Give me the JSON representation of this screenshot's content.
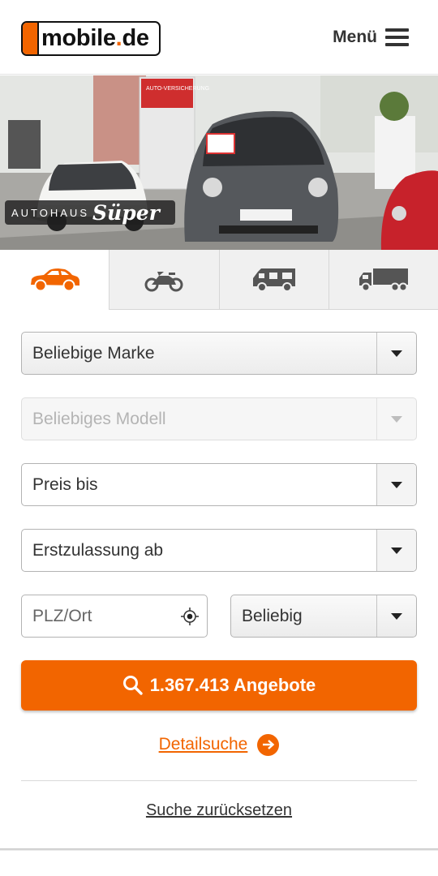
{
  "header": {
    "logo": {
      "text_main": "mobile",
      "text_dot": ".",
      "text_tld": "de"
    },
    "menu_label": "Menü",
    "menu_icon": "hamburger-icon"
  },
  "hero": {
    "dealer_prefix": "AUTOHAUS",
    "dealer_name": "Süper",
    "poster_text": "AUTO-VERSICHERUNG"
  },
  "vehicle_tabs": [
    {
      "icon": "car-icon",
      "active": true
    },
    {
      "icon": "motorcycle-icon",
      "active": false
    },
    {
      "icon": "motorhome-icon",
      "active": false
    },
    {
      "icon": "truck-icon",
      "active": false
    }
  ],
  "form": {
    "make": "Beliebige Marke",
    "model": "Beliebiges Modell",
    "price": "Preis bis",
    "first_registration": "Erstzulassung ab",
    "zip_placeholder": "PLZ/Ort",
    "radius": "Beliebig"
  },
  "search_button": {
    "label": "1.367.413 Angebote",
    "icon": "search-icon"
  },
  "detail_search": "Detailsuche",
  "reset_search": "Suche zurücksetzen",
  "colors": {
    "accent": "#f26500",
    "text": "#333333"
  }
}
